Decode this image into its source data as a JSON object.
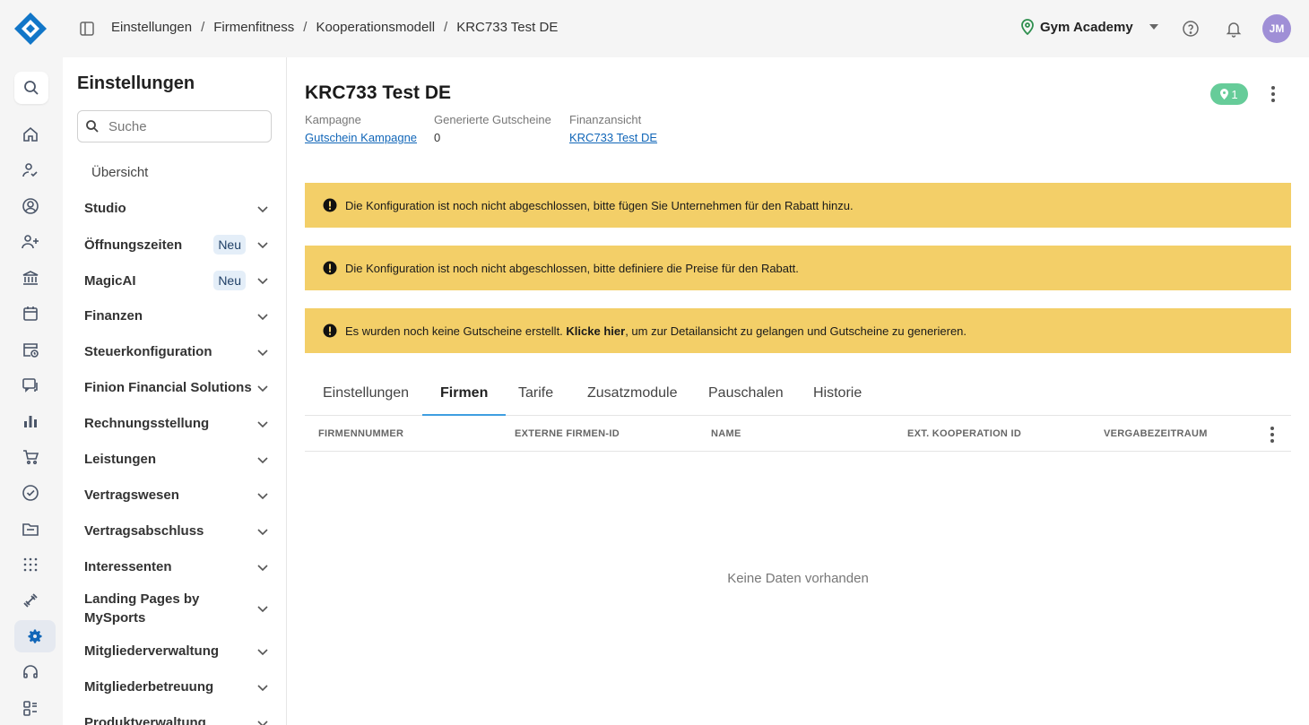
{
  "breadcrumb": [
    "Einstellungen",
    "Firmenfitness",
    "Kooperationsmodell",
    "KRC733 Test DE"
  ],
  "header": {
    "gym_name": "Gym Academy",
    "avatar_initials": "JM"
  },
  "sidebar": {
    "title": "Einstellungen",
    "search_placeholder": "Suche",
    "overview": "Übersicht",
    "items": [
      {
        "label": "Studio"
      },
      {
        "label": "Öffnungszeiten",
        "badge": "Neu"
      },
      {
        "label": "MagicAI",
        "badge": "Neu"
      },
      {
        "label": "Finanzen"
      },
      {
        "label": "Steuerkonfiguration"
      },
      {
        "label": "Finion Financial Solutions"
      },
      {
        "label": "Rechnungsstellung"
      },
      {
        "label": "Leistungen"
      },
      {
        "label": "Vertragswesen"
      },
      {
        "label": "Vertragsabschluss"
      },
      {
        "label": "Interessenten"
      },
      {
        "label": "Landing Pages by MySports"
      },
      {
        "label": "Mitgliederverwaltung"
      },
      {
        "label": "Mitgliederbetreuung"
      },
      {
        "label": "Produktverwaltung"
      }
    ]
  },
  "page": {
    "title": "KRC733 Test DE",
    "pin_count": "1",
    "meta": [
      {
        "key": "Kampagne",
        "value": "Gutschein Kampagne",
        "link": true
      },
      {
        "key": "Generierte Gutscheine",
        "value": "0",
        "link": false
      },
      {
        "key": "Finanzansicht",
        "value": "KRC733 Test DE",
        "link": true
      }
    ]
  },
  "alerts": {
    "a1": "Die Konfiguration ist noch nicht abgeschlossen, bitte fügen Sie Unternehmen für den Rabatt hinzu.",
    "a2": "Die Konfiguration ist noch nicht abgeschlossen, bitte definiere die Preise für den Rabatt.",
    "a3_pre": "Es wurden noch keine Gutscheine erstellt. ",
    "a3_bold": "Klicke hier",
    "a3_post": ", um zur Detailansicht zu gelangen und Gutscheine zu generieren."
  },
  "tabs": [
    "Einstellungen",
    "Firmen",
    "Tarife",
    "Zusatzmodule",
    "Pauschalen",
    "Historie"
  ],
  "active_tab": "Firmen",
  "table": {
    "columns": [
      "FIRMENNUMMER",
      "EXTERNE FIRMEN-ID",
      "NAME",
      "EXT. KOOPERATION ID",
      "VERGABEZEITRAUM"
    ],
    "empty_text": "Keine Daten vorhanden"
  },
  "colors": {
    "accent": "#1166b8",
    "warning": "#f3cf68",
    "pin_badge": "#66cc99",
    "tab_underline": "#3f9ee0",
    "avatar": "#9f8fd6"
  },
  "icons": [
    "logo-icon",
    "panel-toggle-icon",
    "location-pin-icon",
    "help-icon",
    "bell-icon",
    "search-icon",
    "home-icon",
    "user-check-icon",
    "user-circle-icon",
    "user-add-icon",
    "bank-icon",
    "calendar-icon",
    "calendar-clock-icon",
    "chat-icon",
    "bar-chart-icon",
    "cart-icon",
    "check-circle-icon",
    "folder-icon",
    "dots-grid-icon",
    "dumbbell-icon",
    "gear-icon",
    "headset-icon",
    "apps-icon",
    "chevron-down-icon",
    "alert-circle-icon",
    "more-vertical-icon"
  ]
}
